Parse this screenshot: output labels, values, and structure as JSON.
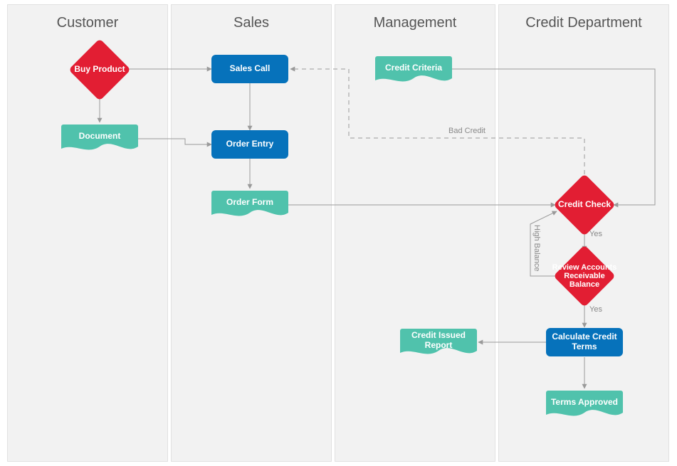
{
  "lanes": {
    "customer": "Customer",
    "sales": "Sales",
    "management": "Management",
    "credit": "Credit Department"
  },
  "nodes": {
    "buy_product": "Buy Product",
    "document": "Document",
    "sales_call": "Sales Call",
    "order_entry": "Order Entry",
    "order_form": "Order Form",
    "credit_criteria": "Credit Criteria",
    "credit_check": "Credit Check",
    "review_balance": "Review Accounts Receivable Balance",
    "calculate_terms": "Calculate Credit Terms",
    "credit_issued": "Credit Issued Report",
    "terms_approved": "Terms Approved"
  },
  "edge_labels": {
    "bad_credit": "Bad Credit",
    "high_balance": "High Balance",
    "yes1": "Yes",
    "yes2": "Yes"
  },
  "colors": {
    "red": "#e21e33",
    "teal": "#50c2ac",
    "blue": "#0672bb",
    "lane_bg": "#f2f2f2",
    "line": "#9a9a9a"
  }
}
